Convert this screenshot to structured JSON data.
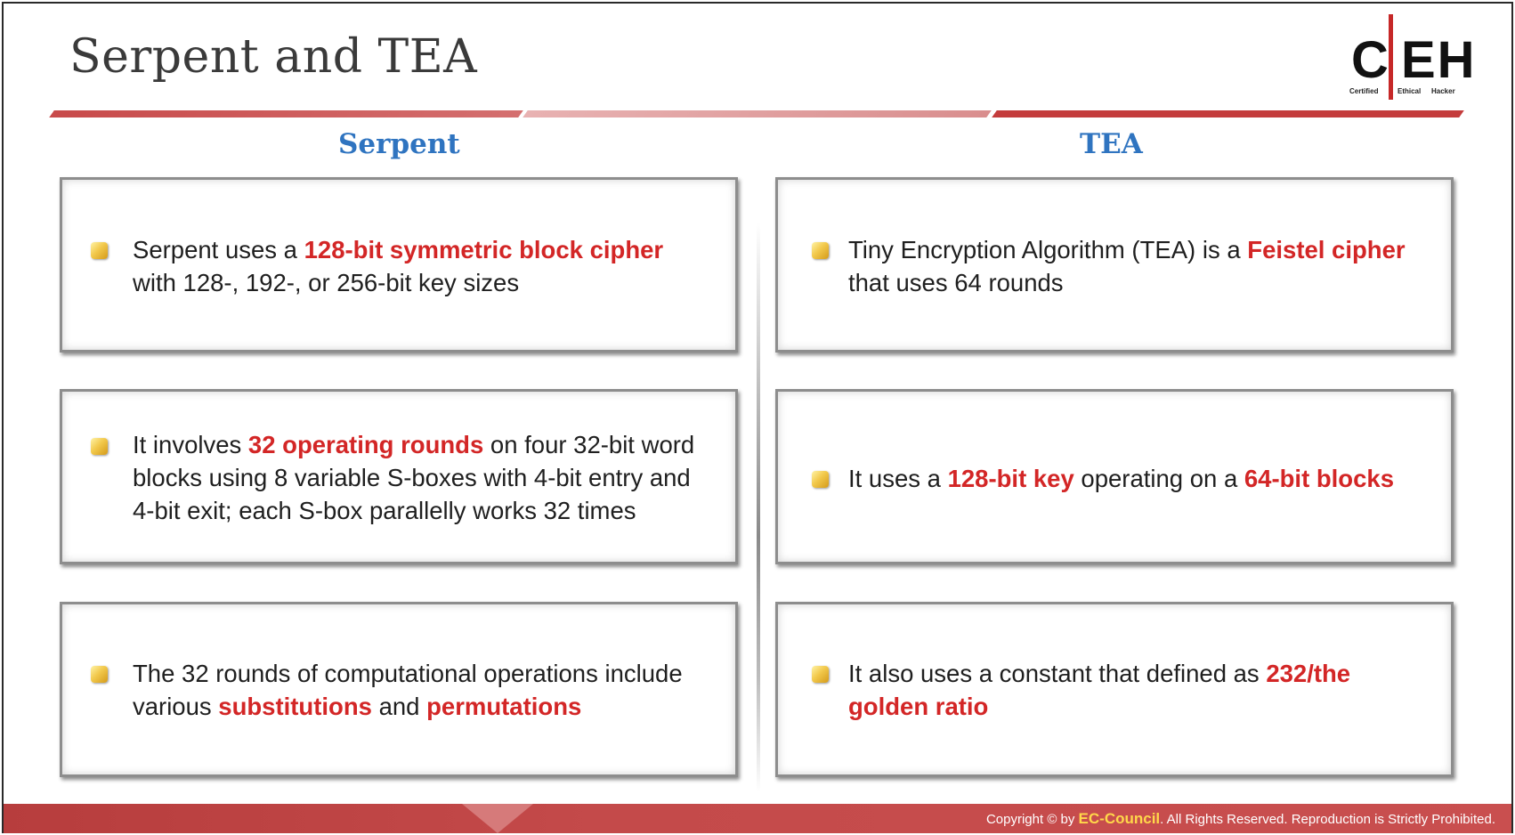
{
  "title": "Serpent and TEA",
  "logo": {
    "c": "C",
    "eh": "EH",
    "sub1": "Certified",
    "sub2": "Ethical",
    "sub3": "Hacker"
  },
  "columns": {
    "left_heading": "Serpent",
    "right_heading": "TEA"
  },
  "serpent": [
    {
      "parts": [
        "Serpent uses a ",
        "128-bit symmetric block cipher"
      ],
      "line2": [
        "with 128-, 192-, or 256-bit key sizes"
      ]
    },
    {
      "line1a": "It involves ",
      "line1b": "32 operating rounds",
      "line1c": " on four 32-bit word",
      "line2": "blocks using 8 variable S-boxes with 4-bit entry and",
      "line3": "4-bit exit; each S-box parallelly works 32 times"
    },
    {
      "line1": "The 32 rounds of computational operations include",
      "line2a": "various ",
      "line2b": "substitutions",
      "line2c": " and ",
      "line2d": "permutations"
    }
  ],
  "tea": [
    {
      "line1a": "Tiny Encryption Algorithm (TEA) is a ",
      "line1b": "Feistel cipher",
      "line2": "that uses 64 rounds"
    },
    {
      "line1a": "It uses a ",
      "line1b": "128-bit key",
      "line1c": " operating on a ",
      "line1d": "64-bit blocks"
    },
    {
      "line1a": "It also uses a constant that defined as ",
      "line1b": "232/the",
      "line2": "golden ratio"
    }
  ],
  "footer": {
    "pre": "Copyright © by ",
    "brand": "EC-Council",
    "post": ". All Rights Reserved. Reproduction  is Strictly  Prohibited."
  },
  "colors": {
    "accent_red": "#d32626",
    "heading_blue": "#2f74c0",
    "footer_red": "#c44a4a"
  }
}
